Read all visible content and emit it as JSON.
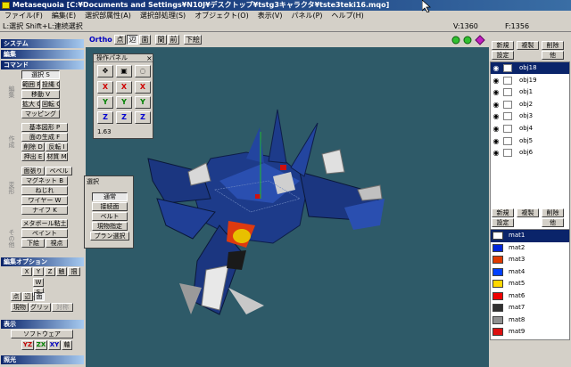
{
  "window": {
    "title": "Metasequoia [C:¥Documents and Settings¥N10J¥デスクトップ¥tstg3キャラクタ¥tste3teki16.mqo]"
  },
  "menu": [
    "ファイル(F)",
    "編集(E)",
    "選択部属性(A)",
    "選択部処理(S)",
    "オブジェクト(O)",
    "表示(V)",
    "パネル(P)",
    "ヘルプ(H)"
  ],
  "status": {
    "hint": "L:選択  Shift+L:連続選択",
    "vertex_count": "V:1360",
    "face_count": "F:1356"
  },
  "left": {
    "system": "システム",
    "edit": "編集",
    "command": "コマンド",
    "cmd1": [
      "選択 S",
      "範囲 R",
      "投縄 G",
      "移動 V",
      "拡大 Q",
      "回転 C",
      "マッピング"
    ],
    "cmd2": [
      "基本図形 P",
      "面の生成 F",
      "削除 D",
      "反転 I",
      "押出 E",
      "材質 M"
    ],
    "cmd3": [
      "面張り",
      "ベベル",
      "マグネット B",
      "ねじれ",
      "ワイヤー W",
      "ナイフ K"
    ],
    "cmd4": [
      "メタボール粘土",
      "ペイント",
      "下絵",
      "視点"
    ],
    "edit_option": "編集オプション",
    "opt": [
      "X",
      "Y",
      "Z",
      "触",
      "掴",
      "W",
      "S",
      "点",
      "辺",
      "面",
      "現物",
      "グリッド",
      "対称"
    ],
    "display": "表示",
    "software": "ソフトウェア",
    "axes": [
      "YZ",
      "ZX",
      "XY",
      "軸"
    ],
    "light": "照光"
  },
  "toolbar": {
    "ortho": "Ortho",
    "modes": [
      "点",
      "辺",
      "面",
      "間",
      "前",
      "下絵"
    ]
  },
  "ops": {
    "title": "操作パネル",
    "axes": [
      "X",
      "X",
      "X",
      "Y",
      "Y",
      "Y",
      "Z",
      "Z",
      "Z"
    ],
    "value": "1.63"
  },
  "sel": {
    "title": "選択",
    "items": [
      "通常",
      "接続面",
      "ベルト",
      "現物指定",
      "プラン選択"
    ]
  },
  "objects": {
    "buttons": [
      "新規",
      "複製",
      "削除"
    ],
    "buttons2": [
      "設定",
      "他"
    ],
    "items": [
      "obj18",
      "obj19",
      "obj1",
      "obj2",
      "obj3",
      "obj4",
      "obj5",
      "obj6"
    ],
    "selected_index": 0
  },
  "materials": {
    "buttons": [
      "新規",
      "複製",
      "削除"
    ],
    "buttons2": [
      "設定",
      "他"
    ],
    "items": [
      {
        "name": "mat1",
        "color": "#ffffff"
      },
      {
        "name": "mat2",
        "color": "#0026d9"
      },
      {
        "name": "mat3",
        "color": "#e03a00"
      },
      {
        "name": "mat4",
        "color": "#0040ff"
      },
      {
        "name": "mat5",
        "color": "#ffd800"
      },
      {
        "name": "mat6",
        "color": "#ee0000"
      },
      {
        "name": "mat7",
        "color": "#303030"
      },
      {
        "name": "mat8",
        "color": "#909090"
      },
      {
        "name": "mat9",
        "color": "#dd1010"
      }
    ],
    "selected_index": 0
  },
  "colors": {
    "title_start": "#0a246a",
    "title_end": "#3a6ea5",
    "viewport": "#2e5a68"
  }
}
